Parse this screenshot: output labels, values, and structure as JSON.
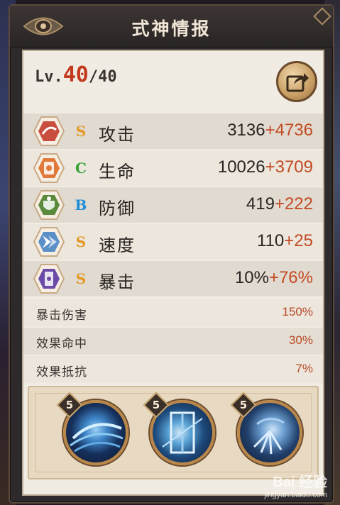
{
  "header": {
    "title": "式神情报"
  },
  "level": {
    "prefix": "Lv.",
    "current": "40",
    "max": "/40"
  },
  "stats": [
    {
      "label": "攻击",
      "rune": "S",
      "rune_color": "#e39a26",
      "base": "3136",
      "bonus": "+4736",
      "icon": "attack-icon"
    },
    {
      "label": "生命",
      "rune": "C",
      "rune_color": "#3aa33b",
      "base": "10026",
      "bonus": "+3709",
      "icon": "health-icon"
    },
    {
      "label": "防御",
      "rune": "B",
      "rune_color": "#1f8ed8",
      "base": "419",
      "bonus": "+222",
      "icon": "defense-icon"
    },
    {
      "label": "速度",
      "rune": "S",
      "rune_color": "#e39a26",
      "base": "110",
      "bonus": "+25",
      "icon": "speed-icon"
    },
    {
      "label": "暴击",
      "rune": "S",
      "rune_color": "#e39a26",
      "base": "10%",
      "bonus": "+76%",
      "icon": "crit-icon"
    }
  ],
  "sub_stats": [
    {
      "label": "暴击伤害",
      "value": "150%"
    },
    {
      "label": "效果命中",
      "value": "30%"
    },
    {
      "label": "效果抵抗",
      "value": "7%"
    }
  ],
  "skills": [
    {
      "level": "5",
      "icon": "wind-slash-skill-icon"
    },
    {
      "level": "5",
      "icon": "ice-gate-skill-icon"
    },
    {
      "level": "5",
      "icon": "frost-wing-skill-icon"
    }
  ],
  "watermark": {
    "logo": "Bai 经验",
    "url": "jingyan.baidu.com"
  },
  "colors": {
    "accent": "#c23a1d",
    "bonus": "#c24a22",
    "panel": "#f1ece3",
    "frame": "#2e2a2b"
  }
}
